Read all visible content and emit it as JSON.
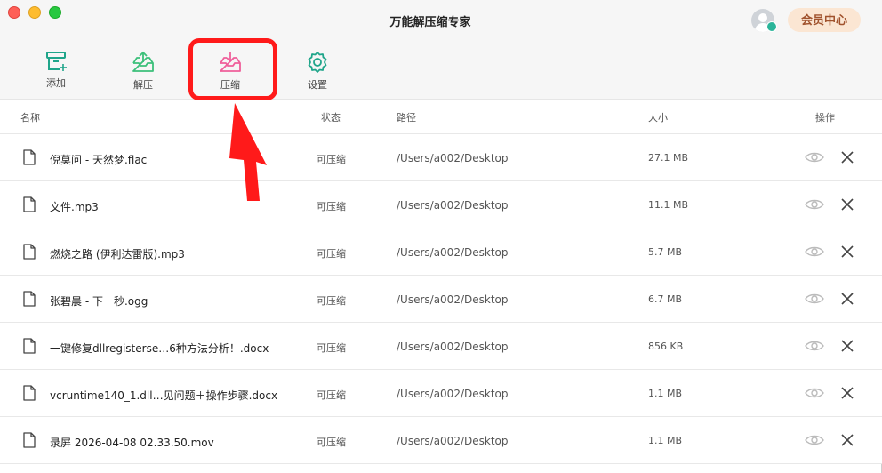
{
  "window": {
    "title": "万能解压缩专家"
  },
  "header": {
    "vip_label": "会员中心"
  },
  "toolbar": {
    "add_label": "添加",
    "extract_label": "解压",
    "compress_label": "压缩",
    "settings_label": "设置"
  },
  "table": {
    "columns": {
      "name": "名称",
      "status": "状态",
      "path": "路径",
      "size": "大小",
      "action": "操作"
    },
    "rows": [
      {
        "name": "倪莫问 - 天然梦.flac",
        "status": "可压缩",
        "path": "/Users/a002/Desktop",
        "size": "27.1 MB"
      },
      {
        "name": "文件.mp3",
        "status": "可压缩",
        "path": "/Users/a002/Desktop",
        "size": "11.1 MB"
      },
      {
        "name": "燃烧之路 (伊利达雷版).mp3",
        "status": "可压缩",
        "path": "/Users/a002/Desktop",
        "size": "5.7 MB"
      },
      {
        "name": "张碧晨 - 下一秒.ogg",
        "status": "可压缩",
        "path": "/Users/a002/Desktop",
        "size": "6.7 MB"
      },
      {
        "name": "一键修复dllregisterse…6种方法分析！.docx",
        "status": "可压缩",
        "path": "/Users/a002/Desktop",
        "size": "856 KB"
      },
      {
        "name": "vcruntime140_1.dll…见问题＋操作步骤.docx",
        "status": "可压缩",
        "path": "/Users/a002/Desktop",
        "size": "1.1 MB"
      },
      {
        "name": "录屏 2026-04-08 02.33.50.mov",
        "status": "可压缩",
        "path": "/Users/a002/Desktop",
        "size": "1.1 MB"
      }
    ]
  },
  "colors": {
    "accent_teal": "#1fa58a",
    "extract_green": "#3cc07a",
    "compress_pink": "#ef5f9a",
    "highlight_red": "#ff1a1a",
    "vip_bg": "#fbe6d3",
    "vip_text": "#a0522d"
  },
  "icons": {
    "add": "archive-box-plus-icon",
    "extract": "tray-upload-icon",
    "compress": "tray-download-icon",
    "settings": "gear-icon",
    "file": "file-icon",
    "preview": "eye-icon",
    "remove": "close-icon"
  }
}
